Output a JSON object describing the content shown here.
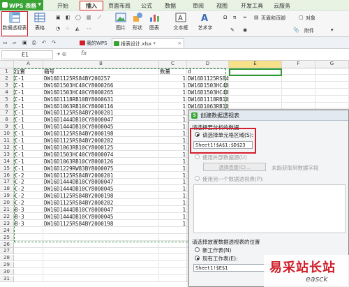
{
  "app": {
    "title": "WPS 表格"
  },
  "menu": {
    "tabs": [
      "开始",
      "插入",
      "页面布局",
      "公式",
      "数据",
      "审阅",
      "视图",
      "开发工具",
      "云服务"
    ],
    "active_tab": "插入"
  },
  "ribbon": {
    "items": [
      "数据透视表",
      "表格",
      "图片",
      "形状",
      "图表",
      "文本框",
      "艺术字",
      "页眉和页脚",
      "对象",
      "附件"
    ],
    "pivot_label": "数据透视表"
  },
  "doc_tabs": {
    "mywps": "我的WPS",
    "file": "报表设计.xlsx *"
  },
  "formula_bar": {
    "name_box": "E1",
    "fx": "fx",
    "value": ""
  },
  "columns": [
    "A",
    "B",
    "C",
    "D",
    "E",
    "F",
    "G"
  ],
  "active_column": "E",
  "rows": [
    [
      "位置",
      "箱号",
      "数量",
      "d"
    ],
    [
      "C-1",
      "DW16D1125RS84BY200257",
      "1",
      "DW16D1125RS84BY2"
    ],
    [
      "C-1",
      "DW16D1503HC40CY8000266",
      "1",
      "DW16D1503HC40CY8"
    ],
    [
      "C-1",
      "DW16D1503HC40CY8000265",
      "1",
      "DW16D1503HC40CY8"
    ],
    [
      "C-1",
      "DW16D1118RB10BY8000631",
      "1",
      "DW16D1118RB10BY8"
    ],
    [
      "C-1",
      "DW16D1063RB10CY8000116",
      "1",
      "DW16D1063RB10CY8"
    ],
    [
      "C-1",
      "DW16D1125RS84BY2000201",
      "1",
      ""
    ],
    [
      "C-1",
      "DW16D1444DB10CY8000047",
      "1",
      ""
    ],
    [
      "C-1",
      "DW16D1444DB10CY8000045",
      "1",
      ""
    ],
    [
      "C-1",
      "DW16D1125RS84BY2000198",
      "1",
      ""
    ],
    [
      "C-1",
      "DW16D1125RS84BY2000202",
      "1",
      ""
    ],
    [
      "C-1",
      "DW16D1063RB10CY8000125",
      "1",
      ""
    ],
    [
      "C-1",
      "DW16D1503HC40CY8000074",
      "1",
      ""
    ],
    [
      "C-1",
      "DW16D1063RB10CY8000126",
      "1",
      ""
    ],
    [
      "C-1",
      "DW16D1229RW83BY8000075",
      "1",
      ""
    ],
    [
      "C-2",
      "DW16D1125RS84BY2000201",
      "1",
      ""
    ],
    [
      "C-2",
      "DW16D1444DB10CY8000047",
      "1",
      ""
    ],
    [
      "C-2",
      "DW16D1444DB10CY8000045",
      "1",
      ""
    ],
    [
      "C-2",
      "DW16D1125RS84BY2000198",
      "1",
      ""
    ],
    [
      "C-2",
      "DW16D1125RS84BY2000202",
      "1",
      ""
    ],
    [
      "B-3",
      "DW16D1444DB10CY8000047",
      "1",
      ""
    ],
    [
      "B-3",
      "DW16D1444DB10CY8000045",
      "1",
      ""
    ],
    [
      "B-3",
      "DW16D1125RS84BY2000198",
      "1",
      ""
    ],
    [
      "",
      "",
      "",
      ""
    ],
    [
      "",
      "",
      "",
      ""
    ],
    [
      "",
      "",
      "",
      ""
    ],
    [
      "",
      "",
      "",
      ""
    ],
    [
      "",
      "",
      "",
      ""
    ],
    [
      "",
      "",
      "",
      ""
    ],
    [
      "",
      "",
      "",
      ""
    ],
    [
      "",
      "",
      "",
      ""
    ]
  ],
  "dialog": {
    "title": "创建数据透视表",
    "section_source": "请选择要分析的数据",
    "opt_range": "请选择单元格区域(S):",
    "range_value": "Sheet1!$A$1:$D$23",
    "opt_external": "使用外部数据源(U)",
    "choose_conn": "选择连接(C)...",
    "no_fields": "未能获取到数据字段",
    "opt_another": "使用另一个数据透视表(P):",
    "section_place": "请选择放置数据透视表的位置",
    "opt_new_sheet": "新工作表(N)",
    "opt_existing": "现有工作表(E):",
    "dest_value": "Sheet1!$E$1"
  },
  "watermark": {
    "cn": "易采站长站",
    "en": "easck"
  },
  "colors": {
    "accent_green": "#3aa335",
    "highlight_red": "#d4202c"
  }
}
